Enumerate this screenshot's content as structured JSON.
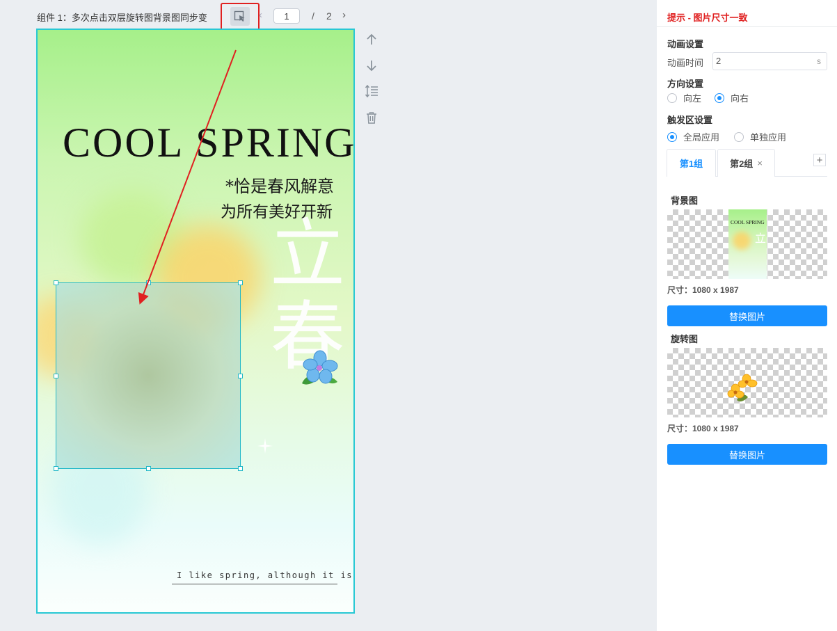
{
  "toolbar": {
    "component_title": "组件 1：多次点击双层旋转图背景图同步变",
    "page_current": "1",
    "page_separator": "/",
    "page_total": "2",
    "select_tool_icon": "cursor-select-icon"
  },
  "canvas": {
    "title": "COOL SPRING",
    "subtitle_line1": "*恰是春风解意",
    "subtitle_line2": "为所有美好开新",
    "big_char1": "立",
    "big_char2": "春",
    "footer_text": "I like spring, although it is hot #"
  },
  "side_tools": [
    "arrow-up-icon",
    "arrow-down-icon",
    "line-height-icon",
    "trash-icon"
  ],
  "panel": {
    "tip": "提示 - 图片尺寸一致",
    "animation": {
      "section_title": "动画设置",
      "duration_label": "动画时间",
      "duration_value": "2",
      "duration_unit": "s"
    },
    "direction": {
      "section_title": "方向设置",
      "options": [
        "向左",
        "向右"
      ],
      "selected": "向右"
    },
    "trigger": {
      "section_title": "触发区设置",
      "options": [
        "全局应用",
        "单独应用"
      ],
      "selected": "全局应用"
    },
    "tabs": [
      {
        "label": "第1组",
        "active": true
      },
      {
        "label": "第2组",
        "active": false,
        "close": "×"
      }
    ],
    "add_tab_label": "+",
    "background_image": {
      "label": "背景图",
      "size_text": "尺寸：1080 x 1987",
      "thumb_title": "COOL SPRING",
      "button_label": "替换图片"
    },
    "rotate_image": {
      "label": "旋转图",
      "size_text": "尺寸：1080 x 1987",
      "button_label": "替换图片"
    }
  },
  "colors": {
    "accent": "#1890ff",
    "tip_red": "#e02020",
    "canvas_border": "#28c8d4"
  }
}
